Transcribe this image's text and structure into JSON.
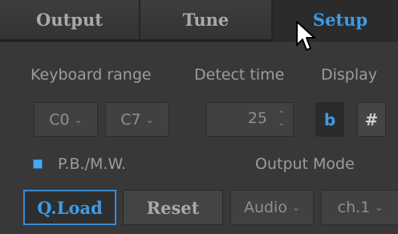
{
  "tabs": {
    "output": "Output",
    "tune": "Tune",
    "setup": "Setup",
    "active": "setup"
  },
  "labels": {
    "keyboard_range": "Keyboard range",
    "detect_time": "Detect time",
    "display": "Display",
    "pbmw": "P.B./M.W.",
    "output_mode": "Output Mode"
  },
  "keyboard_range": {
    "low": "C0",
    "high": "C7"
  },
  "detect_time": {
    "value": "25"
  },
  "display": {
    "flat_label": "b",
    "sharp_label": "#",
    "selected": "b"
  },
  "pbmw": {
    "enabled": true
  },
  "buttons": {
    "qload": "Q.Load",
    "reset": "Reset"
  },
  "output_mode": {
    "type": "Audio",
    "channel": "ch.1"
  },
  "colors": {
    "accent": "#3d9be8",
    "panel": "#383838",
    "text": "#9c9c9c"
  }
}
